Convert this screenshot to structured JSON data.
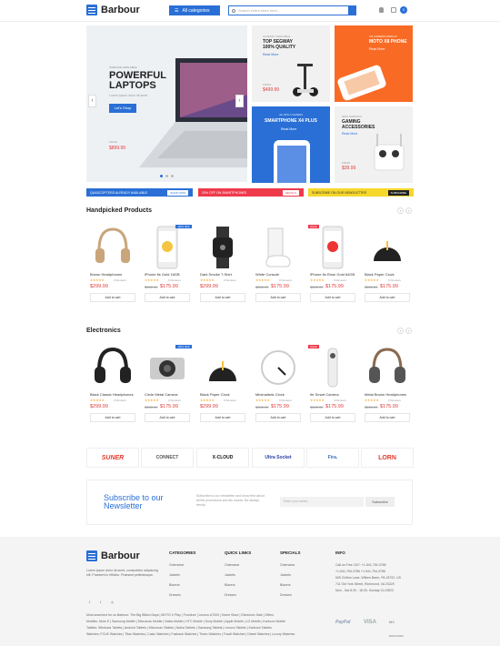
{
  "header": {
    "logo": "Barbour",
    "categories": "All categories",
    "search_placeholder": "Search entire store here...",
    "cart_count": "0"
  },
  "hero": {
    "kicker": "SURFACE AVAILABLE",
    "title": "POWERFUL LAPTOPS",
    "subtitle": "Lorem ipsum dolor sit amet.",
    "button": "Let's Shop",
    "from": "FROM",
    "price": "$899.99"
  },
  "tiles": [
    {
      "kicker": "ALREADY AVAILABLE",
      "title": "TOP SEGWAY 100% QUALITY",
      "link": "Read More",
      "from": "FROM",
      "price": "$499.99"
    },
    {
      "kicker": "4.8 CAMERA DISPLAY",
      "title": "MOTO X8 PHONE",
      "link": "Read More"
    },
    {
      "kicker": "4G WITH CAMERA",
      "title": "SMARTPHONE X4 PLUS",
      "link": "Read More"
    },
    {
      "kicker": "NEW ARRIVALS",
      "title": "GAMING ACCESSORIES",
      "link": "Read More",
      "from": "FROM",
      "price": "$39.99"
    }
  ],
  "strips": [
    {
      "text": "QUADCOPTERS ALREADY AVAILABLE",
      "button": "SHOP NOW"
    },
    {
      "text": "20% OFF ON SMARTPHONES",
      "button": "DETAILS"
    },
    {
      "text": "SUBSCRIBE ON OUR NEWSLETTER",
      "button": "SUBSCRIBE"
    }
  ],
  "handpicked": {
    "title": "Handpicked Products",
    "items": [
      {
        "name": "Brown Headphones",
        "reviews": "0 Reviews",
        "price": "$299.99",
        "old": "",
        "badge": "",
        "add": "Add to cart"
      },
      {
        "name": "iPhone 6s Gold 16GB",
        "reviews": "0 Reviews",
        "price": "$175.99",
        "old": "$289.99",
        "badge": "-30% OFF",
        "add": "Add to cart"
      },
      {
        "name": "Dark Smoke T-Shirt",
        "reviews": "0 Reviews",
        "price": "$299.99",
        "old": "",
        "badge": "",
        "add": "Add to cart"
      },
      {
        "name": "White Console",
        "reviews": "0 Reviews",
        "price": "$175.99",
        "old": "$289.99",
        "badge": "",
        "add": "Add to cart"
      },
      {
        "name": "iPhone 6s Rose Gold 64GB",
        "reviews": "0 Reviews",
        "price": "$175.99",
        "old": "$289.99",
        "badge": "SALE",
        "add": "Add to cart"
      },
      {
        "name": "Black Paper Clock",
        "reviews": "0 Reviews",
        "price": "$175.99",
        "old": "$289.99",
        "badge": "",
        "add": "Add to cart"
      }
    ]
  },
  "electronics": {
    "title": "Electronics",
    "items": [
      {
        "name": "Black Classic Headphones",
        "reviews": "0 Reviews",
        "price": "$299.99",
        "old": "",
        "badge": "",
        "add": "Add to cart"
      },
      {
        "name": "Circle Metal Camera",
        "reviews": "0 Reviews",
        "price": "$175.99",
        "old": "$289.99",
        "badge": "-30% OFF",
        "add": "Add to cart"
      },
      {
        "name": "Black Paper Clock",
        "reviews": "0 Reviews",
        "price": "$299.99",
        "old": "",
        "badge": "",
        "add": "Add to cart"
      },
      {
        "name": "Minimalistic Clock",
        "reviews": "0 Reviews",
        "price": "$175.99",
        "old": "$289.99",
        "badge": "",
        "add": "Add to cart"
      },
      {
        "name": "Ife Smart Camera",
        "reviews": "0 Reviews",
        "price": "$175.99",
        "old": "$289.99",
        "badge": "SALE",
        "add": "Add to cart"
      },
      {
        "name": "Metal Brown Headphones",
        "reviews": "0 Reviews",
        "price": "$175.99",
        "old": "$289.99",
        "badge": "",
        "add": "Add to cart"
      }
    ]
  },
  "stars": "★★★★★",
  "brands": [
    "SUNER",
    "CONNECT",
    "X-CLOUD",
    "Ultra Socket",
    "Fira.",
    "LORN"
  ],
  "subscribe": {
    "heading": "Subscribe to our Newsletter",
    "desc": "Subscribe to our newsletter and know first about all the promotions and dis counts. Be always trendy.",
    "placeholder": "Enter your email...",
    "button": "Subscribe"
  },
  "footer": {
    "logo": "Barbour",
    "about": "Lorem ipsum dolor sit amet, consectetur adipiscing elit. Praesent in efficitur. Praesent pellentesque.",
    "social": [
      "f",
      "t",
      "◎"
    ],
    "categories": {
      "title": "CATEGORIES",
      "items": [
        "Outerwear",
        "Jackets",
        "Blazers",
        "Dresses"
      ]
    },
    "quick": {
      "title": "QUICK LINKS",
      "items": [
        "Outerwear",
        "Jackets",
        "Blazers",
        "Dresses"
      ]
    },
    "specials": {
      "title": "SPECIALS",
      "items": [
        "Outerwear",
        "Jackets",
        "Blazers",
        "Dresses"
      ]
    },
    "info": {
      "title": "INFO",
      "lines": [
        "Call us Free 24/7: +1-541-754-3786",
        "+1-541-754-3786 +1-541-754-3786",
        "605 Chilton Lane, Wilkes Barre, PA 18702, US",
        "711 Old York Street, Richmond, VA 23229",
        "Mon - Sat 8.00 - 18.00, Sunday CLOSED"
      ]
    },
    "bottom": [
      "Most searched for on Barbour: The Big Billion Days | MOTO X Play | Furniture | Lenovo A7000 | Home Store | Electronic Sale | Offers",
      "Mobiles: Moto E | Samsung Mobile | Micromax Mobile | Nokia Mobile | HTC Mobile | Sony Mobile | Apple Mobile | LG Mobile | Karbonn Mobile",
      "Tablets: Windows Tablets | Android Tablets | Micromax Tablets | Nokia Tablets | Samsung Tablets | Lenovo Tablets | Karbonn Tablets",
      "Watches: FCUK Watches | Titan Watches | Casio Watches | Fastrack Watches | Timex Watches | Fossil Watches | Diesel Watches | Luxury Watches"
    ],
    "payments": [
      "PayPal",
      "VISA",
      "MC",
      "DISCOVER"
    ]
  }
}
